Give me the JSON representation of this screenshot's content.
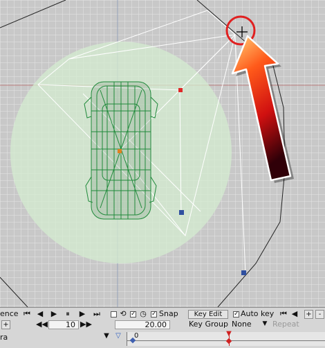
{
  "colors": {
    "viewport_bg": "#c8c8c8",
    "grid": "#e8e8e8",
    "camera_range": "#cde6c8",
    "car_wire": "#1f8a3a",
    "annotation_circle": "#e02020",
    "arrow_gradient": [
      "#ffd27a",
      "#ff5a1a",
      "#d01010",
      "#300008"
    ]
  },
  "icons": {
    "cursor": "crosshair-cursor-icon",
    "go_start": "go-to-start-icon",
    "prev_frame": "previous-frame-icon",
    "play": "play-icon",
    "pause": "pause-icon",
    "next_frame": "next-frame-icon",
    "go_end": "go-to-end-icon",
    "loop": "loop-icon",
    "clock": "clock-icon"
  },
  "timeline": {
    "left_label_top": "ence",
    "left_label_bottom": "ra",
    "plus_label": "+",
    "frame_value": "10",
    "time_value": "20.00",
    "snap_label": "Snap",
    "key_edit_label": "Key Edit",
    "auto_key_label": "Auto key",
    "key_group_label": "Key Group",
    "key_group_value": "None",
    "repeat_label": "Repeat",
    "add_label": "+",
    "remove_label": "-",
    "ruler_start": "0"
  }
}
